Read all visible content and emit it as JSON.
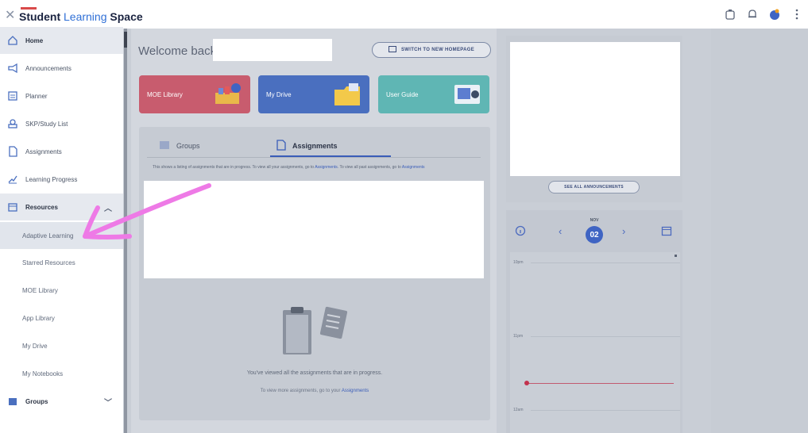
{
  "app": {
    "title_part1": "Student",
    "title_part2": "Learning",
    "title_part3": "Space"
  },
  "sidebar": {
    "items": [
      {
        "label": "Home",
        "icon": "home-icon"
      },
      {
        "label": "Announcements",
        "icon": "megaphone-icon"
      },
      {
        "label": "Planner",
        "icon": "planner-icon"
      },
      {
        "label": "SKP/Study List",
        "icon": "study-list-icon"
      },
      {
        "label": "Assignments",
        "icon": "assignment-icon"
      },
      {
        "label": "Learning Progress",
        "icon": "progress-chart-icon"
      },
      {
        "label": "Resources",
        "icon": "resources-icon"
      }
    ],
    "resources_sub": [
      {
        "label": "Adaptive Learning"
      },
      {
        "label": "Starred Resources"
      },
      {
        "label": "MOE Library"
      },
      {
        "label": "App Library"
      },
      {
        "label": "My Drive"
      },
      {
        "label": "My Notebooks"
      }
    ],
    "groups_label": "Groups"
  },
  "main": {
    "welcome": "Welcome back",
    "switch_button": "SWITCH TO NEW HOMEPAGE",
    "tiles": [
      {
        "label": "MOE Library",
        "color": "#c85c6e"
      },
      {
        "label": "My Drive",
        "color": "#4a6fbf"
      },
      {
        "label": "User Guide",
        "color": "#5fb6b4"
      }
    ],
    "tabs": [
      {
        "label": "Groups"
      },
      {
        "label": "Assignments"
      }
    ],
    "description": "This shows a listing of assignments that are in progress. To view all your assignments, go to",
    "description_link": "Assignments",
    "description_tail": ". To view all past assignments, go to",
    "description_link2": "Assignments",
    "empty_message": "You've viewed all the assignments that are in progress.",
    "empty_link_prefix": "To view more assignments, go to your",
    "empty_link": "Assignments"
  },
  "right": {
    "see_all": "SEE ALL ANNOUNCEMENTS",
    "calendar": {
      "month": "NOV",
      "day": "02",
      "times": [
        "10pm",
        "11pm",
        "12am"
      ]
    }
  },
  "colors": {
    "accent": "#3f64c3",
    "annotation": "#ee7ae6"
  }
}
